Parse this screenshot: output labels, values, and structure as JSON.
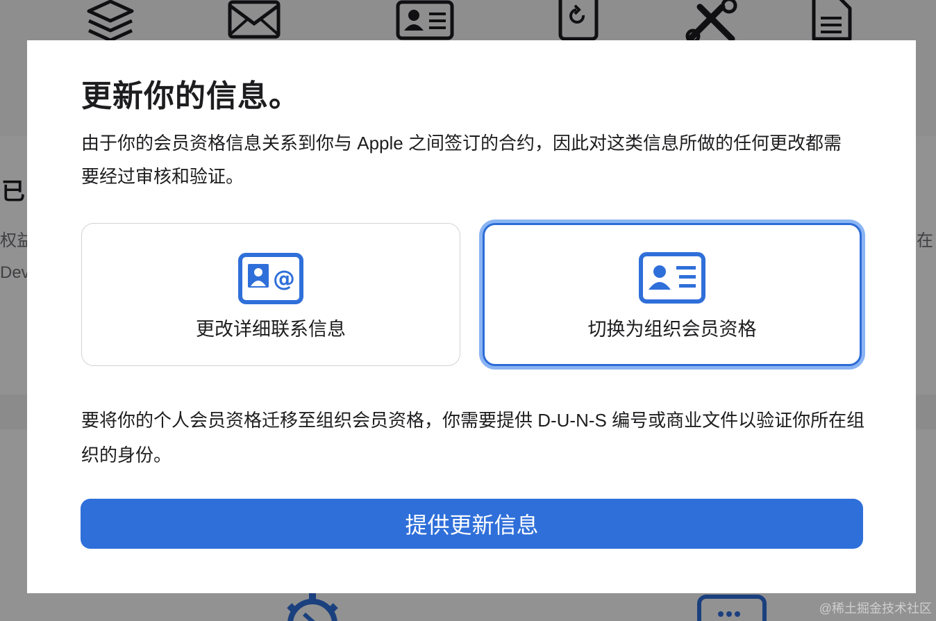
{
  "background": {
    "heading_fragment": "已",
    "para_left_line1": "权益",
    "para_left_line2": "Dev",
    "para_right_line1": "在",
    "icons": [
      "layers-icon",
      "mail-icon",
      "id-card-icon",
      "refresh-device-icon",
      "tools-icon",
      "document-icon",
      "gear-icon",
      "keyboard-icon"
    ]
  },
  "modal": {
    "title": "更新你的信息。",
    "description": "由于你的会员资格信息关系到你与 Apple 之间签订的合约，因此对这类信息所做的任何更改都需要经过审核和验证。",
    "options": [
      {
        "label": "更改详细联系信息",
        "icon": "contact-card-at-icon",
        "selected": false
      },
      {
        "label": "切换为组织会员资格",
        "icon": "id-card-icon",
        "selected": true
      }
    ],
    "note": "要将你的个人会员资格迁移至组织会员资格，你需要提供 D-U-N-S 编号或商业文件以验证你所在组织的身份。",
    "submit_label": "提供更新信息"
  },
  "colors": {
    "accent": "#2f6fd9",
    "selected_ring": "#8ab4f3",
    "text": "#1d1d1f"
  },
  "watermark": "@稀土掘金技术社区"
}
